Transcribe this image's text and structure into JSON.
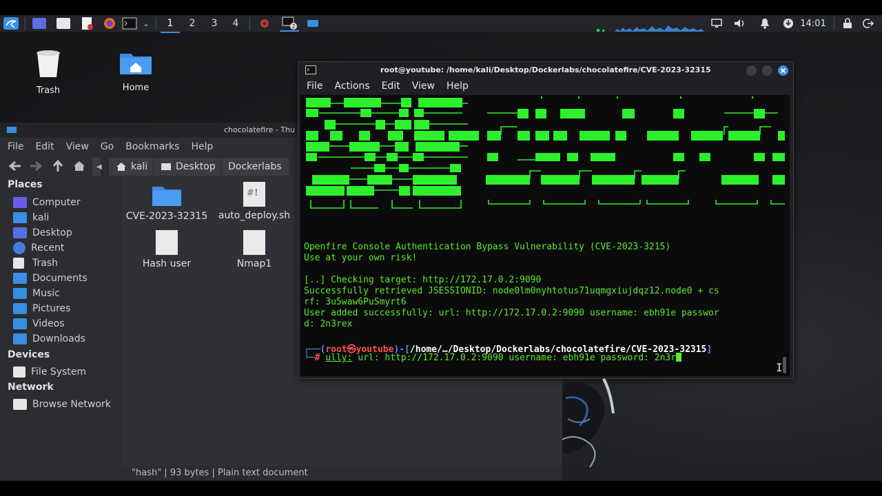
{
  "panel": {
    "workspaces": [
      "1",
      "2",
      "3",
      "4"
    ],
    "terminal_badge": "2",
    "clock": "14:01"
  },
  "desktop": {
    "icons": [
      {
        "label": "Trash"
      },
      {
        "label": "Home"
      }
    ]
  },
  "file_manager": {
    "title": "chocolatefire - Thu",
    "menu": [
      "File",
      "Edit",
      "View",
      "Go",
      "Bookmarks",
      "Help"
    ],
    "breadcrumb": [
      "kali",
      "Desktop",
      "Dockerlabs"
    ],
    "sidebar": {
      "places_header": "Places",
      "places": [
        "Computer",
        "kali",
        "Desktop",
        "Recent",
        "Trash",
        "Documents",
        "Music",
        "Pictures",
        "Videos",
        "Downloads"
      ],
      "devices_header": "Devices",
      "devices": [
        "File System"
      ],
      "network_header": "Network",
      "network": [
        "Browse Network"
      ]
    },
    "files": [
      {
        "name": "CVE-2023-32315",
        "icon": "folder-icon"
      },
      {
        "name": "auto_deploy.sh",
        "icon": "script-file-icon",
        "glyph": "#!"
      },
      {
        "name": "Hash user",
        "icon": "text-file-icon"
      },
      {
        "name": "Nmap1",
        "icon": "text-file-icon"
      }
    ],
    "status": "\"hash\" | 93 bytes | Plain text document"
  },
  "terminal": {
    "title": "root@youtube: /home/kali/Desktop/Dockerlabs/chocolatefire/CVE-2023-32315",
    "menu": [
      "File",
      "Actions",
      "Edit",
      "View",
      "Help"
    ],
    "lines": [
      "Openfire Console Authentication Bypass Vulnerability (CVE-2023-3215)",
      "Use at your own risk!",
      "",
      "[..] Checking target: http://172.17.0.2:9090",
      "Successfully retrieved JSESSIONID: node0lm0nyhtotus71uqmgxiujdqz12.node0 + cs",
      "rf: 3u5waw6PuSmyrt6",
      "User added successfully: url: http://172.17.0.2:9090 username: ebh91e passwor",
      "d: 2n3rex"
    ],
    "prompt": {
      "user": "root",
      "host": "youtube",
      "path": "/home/…/Desktop/Dockerlabs/chocolatefire/CVE-2023-32315",
      "hash": "#",
      "command_word": "ully:",
      "command_rest": " url: http://172.17.0.2:9090 username: ebh91e password: 2n3r"
    },
    "colors": {
      "text": "#5bea2e",
      "banner": "#2cf02c",
      "prompt_user": "#ff4f4f",
      "prompt_path": "#4f8fff"
    }
  }
}
